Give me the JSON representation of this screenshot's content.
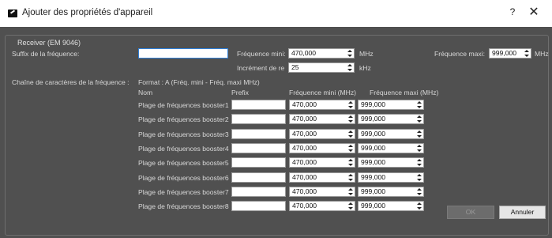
{
  "window": {
    "title": "Ajouter des propriétés d'appareil",
    "help_glyph": "?",
    "close_glyph": "✕",
    "logo_icon": "sennheiser-logo-icon"
  },
  "group": {
    "title": "Receiver (EM 9046)"
  },
  "fields": {
    "suffix_label": "Suffix de la fréquence:",
    "suffix_value": "",
    "freq_min_label": "Fréquence mini:",
    "freq_min_value": "470,000",
    "freq_min_unit": "MHz",
    "freq_max_label": "Fréquence maxi:",
    "freq_max_value": "999,000",
    "freq_max_unit": "MHz",
    "increment_label": "Incrément de re",
    "increment_value": "25",
    "increment_unit": "kHz",
    "chain_label": "Chaîne de caractères de la fréquence :",
    "format_text": "Format : A (Fréq. mini - Fréq. maxi MHz)"
  },
  "table": {
    "headers": {
      "name": "Nom",
      "prefix": "Prefix",
      "fmin": "Fréquence mini (MHz)",
      "fmax": "Fréquence maxi (MHz)"
    },
    "rows": [
      {
        "name": "Plage de fréquences booster1",
        "prefix": "",
        "fmin": "470,000",
        "fmax": "999,000"
      },
      {
        "name": "Plage de fréquences booster2",
        "prefix": "",
        "fmin": "470,000",
        "fmax": "999,000"
      },
      {
        "name": "Plage de fréquences booster3",
        "prefix": "",
        "fmin": "470,000",
        "fmax": "999,000"
      },
      {
        "name": "Plage de fréquences booster4",
        "prefix": "",
        "fmin": "470,000",
        "fmax": "999,000"
      },
      {
        "name": "Plage de fréquences booster5",
        "prefix": "",
        "fmin": "470,000",
        "fmax": "999,000"
      },
      {
        "name": "Plage de fréquences booster6",
        "prefix": "",
        "fmin": "470,000",
        "fmax": "999,000"
      },
      {
        "name": "Plage de fréquences booster7",
        "prefix": "",
        "fmin": "470,000",
        "fmax": "999,000"
      },
      {
        "name": "Plage de fréquences booster8",
        "prefix": "",
        "fmin": "470,000",
        "fmax": "999,000"
      }
    ]
  },
  "buttons": {
    "ok": "OK",
    "cancel": "Annuler"
  },
  "colors": {
    "dialog_bg": "#505050",
    "focus_border": "#2f7fd8"
  }
}
